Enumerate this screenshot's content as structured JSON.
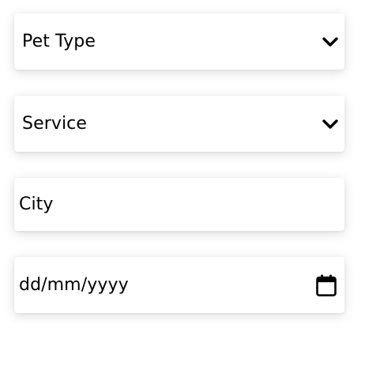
{
  "form": {
    "pet_type": {
      "selected": "Pet Type",
      "icon": "chevron-down-icon"
    },
    "service": {
      "selected": "Service",
      "icon": "chevron-down-icon"
    },
    "city": {
      "placeholder": "City"
    },
    "date": {
      "placeholder": "dd/mm/yyyy",
      "icon": "calendar-icon"
    }
  }
}
